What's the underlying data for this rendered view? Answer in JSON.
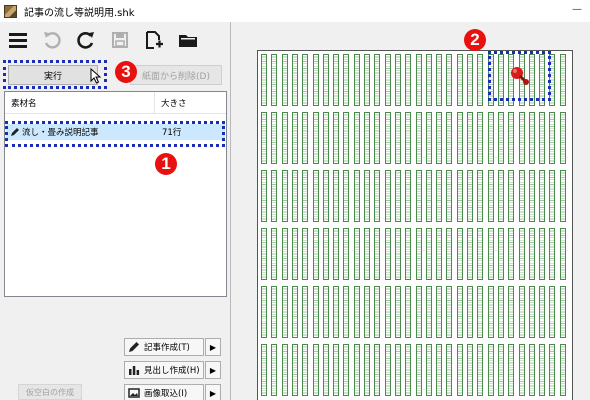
{
  "window": {
    "title": "記事の流し等説明用.shk",
    "minimize_glyph": "—"
  },
  "toolbar": {
    "icons": [
      "menu-icon",
      "undo-icon",
      "redo-icon",
      "save-icon",
      "new-page-icon",
      "folder-icon"
    ]
  },
  "buttons": {
    "run_label": "実行",
    "delete_label": "紙面から削除(D)",
    "blank_label": "仮空白の作成"
  },
  "material_list": {
    "headers": {
      "name": "素材名",
      "size": "大きさ"
    },
    "rows": [
      {
        "name": "流し・畳み説明記事",
        "size": "71行",
        "icon": "pencil-icon"
      }
    ]
  },
  "actions": [
    {
      "label": "記事作成(T)",
      "icon": "pencil-icon",
      "arrow": "▶"
    },
    {
      "label": "見出し作成(H)",
      "icon": "bar-chart-icon",
      "arrow": "▶"
    },
    {
      "label": "画像取込(I)",
      "icon": "image-icon",
      "arrow": "▶"
    }
  ],
  "annotations": {
    "badge1": "1",
    "badge2": "2",
    "badge3": "3",
    "accent_color": "#e8110f",
    "highlight_color": "#1a2db5"
  },
  "layout_paper": {
    "blocks": 6,
    "columns_per_block": 30,
    "grid_color": "#4a8a4a"
  }
}
